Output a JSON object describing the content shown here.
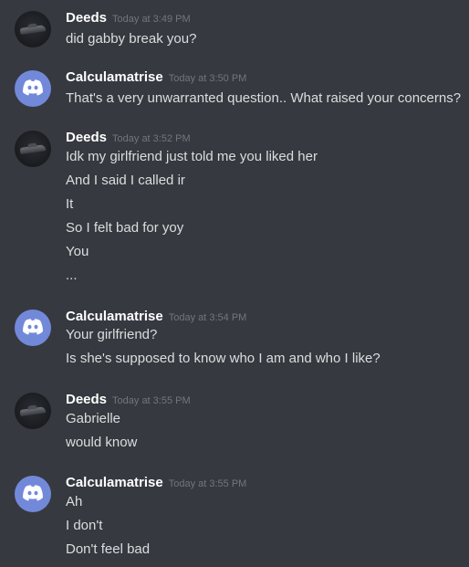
{
  "groups": [
    {
      "user": "Deeds",
      "avatar": "car-avatar-icon",
      "time": "Today at 3:49 PM",
      "lines": [
        "did gabby break you?"
      ]
    },
    {
      "user": "Calculamatrise",
      "avatar": "discord-logo-icon",
      "time": "Today at 3:50 PM",
      "lines": [
        "That's a very unwarranted question.. What raised your concerns?"
      ]
    },
    {
      "user": "Deeds",
      "avatar": "car-avatar-icon",
      "time": "Today at 3:52 PM",
      "lines": [
        "Idk my girlfriend just told me you liked her",
        "And I said I called ir",
        "It",
        "So I felt bad for yoy",
        "You",
        "..."
      ]
    },
    {
      "user": "Calculamatrise",
      "avatar": "discord-logo-icon",
      "time": "Today at 3:54 PM",
      "lines": [
        "Your girlfriend?",
        "Is she's supposed to know who I am and who I like?"
      ]
    },
    {
      "user": "Deeds",
      "avatar": "car-avatar-icon",
      "time": "Today at 3:55 PM",
      "lines": [
        "Gabrielle",
        "would know"
      ]
    },
    {
      "user": "Calculamatrise",
      "avatar": "discord-logo-icon",
      "time": "Today at 3:55 PM",
      "lines": [
        "Ah",
        "I don't",
        "Don't feel bad"
      ]
    }
  ],
  "colors": {
    "background": "#36393f",
    "username": "#ffffff",
    "message": "#dcddde",
    "timestamp": "#72767d",
    "bot_avatar": "#7289da"
  }
}
